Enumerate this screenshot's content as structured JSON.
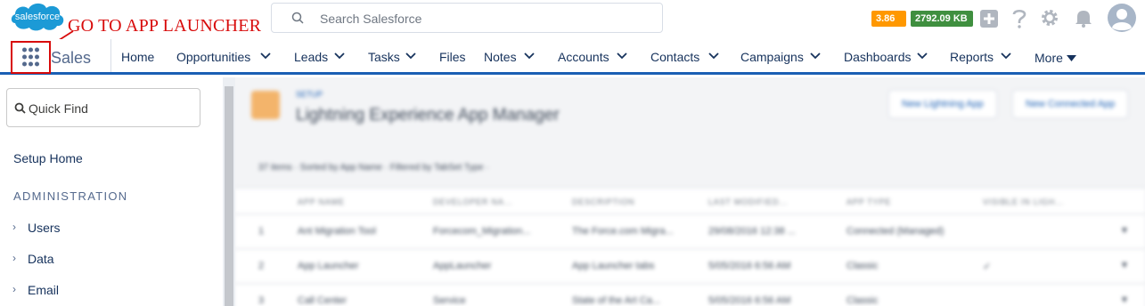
{
  "header": {
    "logo_text": "salesforce",
    "search_placeholder": "Search Salesforce",
    "timing_badge": "3.86 s",
    "memory_badge": "2792.09 KB"
  },
  "annotation": "GO TO APP LAUNCHER",
  "nav": {
    "app_name": "Sales",
    "items": [
      {
        "label": "Home"
      },
      {
        "label": "Opportunities"
      },
      {
        "label": "Leads"
      },
      {
        "label": "Tasks"
      },
      {
        "label": "Files"
      },
      {
        "label": "Notes"
      },
      {
        "label": "Accounts"
      },
      {
        "label": "Contacts"
      },
      {
        "label": "Campaigns"
      },
      {
        "label": "Dashboards"
      },
      {
        "label": "Reports"
      },
      {
        "label": "More"
      }
    ]
  },
  "sidebar": {
    "quick_find_placeholder": "Quick Find",
    "setup_home": "Setup Home",
    "section": "ADMINISTRATION",
    "items": [
      {
        "label": "Users"
      },
      {
        "label": "Data"
      },
      {
        "label": "Email"
      }
    ]
  },
  "main": {
    "setup_label": "SETUP",
    "title": "Lightning Experience App Manager",
    "buttons": {
      "new_lightning": "New Lightning App",
      "new_connected": "New Connected App"
    },
    "summary": "37 items · Sorted by App Name · Filtered by TabSet Type ·",
    "columns": [
      "APP NAME",
      "DEVELOPER NA...",
      "DESCRIPTION",
      "LAST MODIFIED...",
      "APP TYPE",
      "VISIBLE IN LIGH..."
    ],
    "rows": [
      {
        "num": "1",
        "name": "Ant Migration Tool",
        "dev": "Forcecom_Migration...",
        "desc": "The Force.com Migra...",
        "modified": "29/08/2016 12:38 ...",
        "type": "Connected (Managed)",
        "visible": ""
      },
      {
        "num": "2",
        "name": "App Launcher",
        "dev": "AppLauncher",
        "desc": "App Launcher tabs",
        "modified": "5/05/2016 6:56 AM",
        "type": "Classic",
        "visible": "✓"
      },
      {
        "num": "3",
        "name": "Call Center",
        "dev": "Service",
        "desc": "State of the Art Ca...",
        "modified": "5/05/2016 6:56 AM",
        "type": "Classic",
        "visible": ""
      }
    ]
  },
  "colors": {
    "brand_blue": "#1a5fb4",
    "badge_orange": "#ff9800",
    "badge_green": "#3f8f3f",
    "annotation_red": "#d80b0b"
  }
}
